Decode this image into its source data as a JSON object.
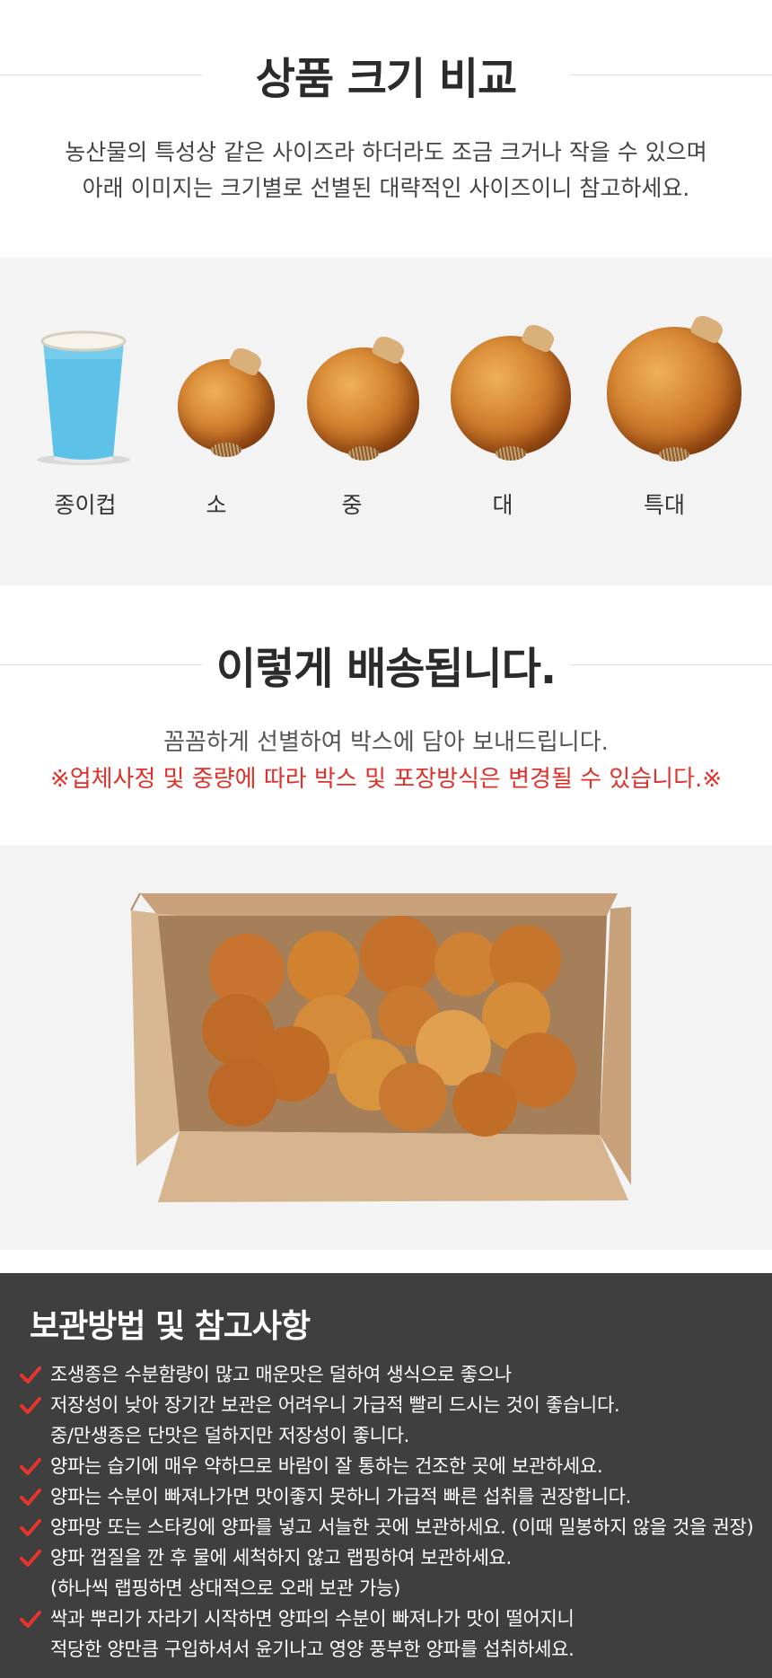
{
  "size_section": {
    "title": "상품 크기 비교",
    "intro_line1": "농산물의 특성상 같은 사이즈라 하더라도 조금 크거나 작을 수 있으며",
    "intro_line2": "아래 이미지는 크기별로 선별된 대략적인 사이즈이니 참고하세요.",
    "items": [
      {
        "label": "종이컵",
        "icon": "paper-cup"
      },
      {
        "label": "소",
        "icon": "onion-small"
      },
      {
        "label": "중",
        "icon": "onion-medium"
      },
      {
        "label": "대",
        "icon": "onion-large"
      },
      {
        "label": "특대",
        "icon": "onion-xlarge"
      }
    ],
    "cup_color": "#5ec2e8"
  },
  "delivery_section": {
    "title": "이렇게 배송됩니다.",
    "line1": "꼼꼼하게 선별하여 박스에 담아 보내드립니다.",
    "line2": "※업체사정 및 중량에 따라 박스 및 포장방식은 변경될 수 있습니다.※",
    "warning_color": "#e0302a"
  },
  "storage_section": {
    "title": "보관방법 및 참고사항",
    "check_color": "#e8352c",
    "tips": [
      {
        "line1": "조생종은 수분함량이 많고 매운맛은 덜하여 생식으로 좋으나",
        "line2": ""
      },
      {
        "line1": "저장성이 낮아 장기간 보관은 어려우니 가급적 빨리 드시는 것이 좋습니다.",
        "line2": "중/만생종은 단맛은 덜하지만 저장성이 좋니다."
      },
      {
        "line1": "양파는 습기에 매우 약하므로 바람이 잘 통하는 건조한 곳에 보관하세요.",
        "line2": ""
      },
      {
        "line1": "양파는 수분이 빠져나가면 맛이좋지 못하니 가급적 빠른 섭취를 권장합니다.",
        "line2": ""
      },
      {
        "line1": "양파망 또는 스타킹에 양파를 넣고 서늘한 곳에 보관하세요. (이때 밀봉하지 않을 것을 권장)",
        "line2": ""
      },
      {
        "line1": "양파 껍질을 깐 후 물에 세척하지 않고 랩핑하여 보관하세요.",
        "line2": "(하나씩 랩핑하면 상대적으로 오래 보관 가능)"
      },
      {
        "line1": "싹과 뿌리가 자라기 시작하면 양파의 수분이 빠져나가 맛이 떨어지니",
        "line2": "적당한 양만큼 구입하셔서 윤기나고 영양 풍부한 양파를 섭취하세요."
      }
    ]
  }
}
